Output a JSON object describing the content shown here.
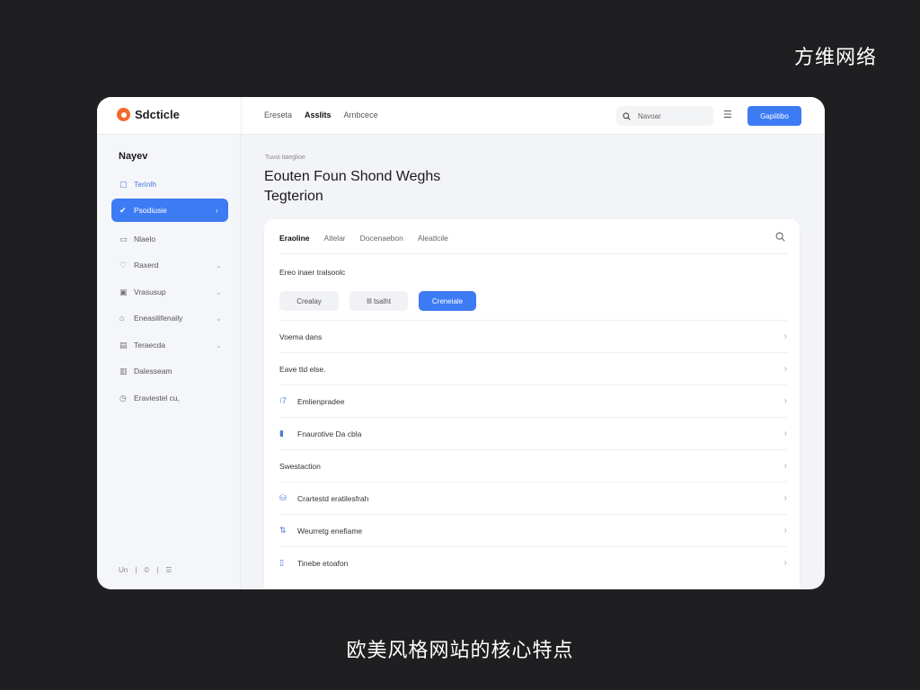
{
  "overlay": {
    "corner_text": "方维网络",
    "caption": "欧美风格网站的核心特点"
  },
  "topbar": {
    "logo_text": "Sdcticle",
    "nav": [
      "Ereseta",
      "Asslits",
      "Arnbcece"
    ],
    "search_placeholder": "Navoar",
    "primary_button": "Gapiitibo"
  },
  "sidebar": {
    "title": "Nayev",
    "items": [
      {
        "label": "Terinlh",
        "icon": "square-icon",
        "glyph": "▢",
        "chevron": false
      },
      {
        "label": "Psodiusie",
        "icon": "check-shield-icon",
        "glyph": "✔",
        "chevron": true
      },
      {
        "label": "Nlaelo",
        "icon": "tag-icon",
        "glyph": "▭",
        "chevron": false
      },
      {
        "label": "Raxerd",
        "icon": "pin-icon",
        "glyph": "♡",
        "chevron": true
      },
      {
        "label": "Vrasusup",
        "icon": "image-icon",
        "glyph": "▣",
        "chevron": true
      },
      {
        "label": "Eneasilifenaily",
        "icon": "home-icon",
        "glyph": "⌂",
        "chevron": true
      },
      {
        "label": "Teraecda",
        "icon": "list-icon",
        "glyph": "▤",
        "chevron": true
      },
      {
        "label": "Dalesseam",
        "icon": "folder-icon",
        "glyph": "▥",
        "chevron": false
      },
      {
        "label": "Eraviestel cu,",
        "icon": "clock-icon",
        "glyph": "◷",
        "chevron": false
      }
    ],
    "footer": [
      "Un",
      "|",
      "©",
      "|",
      "☰"
    ]
  },
  "main": {
    "breadcrumb": "Tuvoi itaeglioe",
    "title_line1": "Eouten Foun Shond Weghs",
    "title_line2": "Tegterion"
  },
  "card": {
    "tabs": [
      "Eraoline",
      "Atlelar",
      "Docenaebon",
      "Aleatlcile"
    ],
    "section_label": "Ereo inaer tralsoolc",
    "pills": [
      "Crealay",
      "Ill tsalht",
      "Creneiale"
    ],
    "rows": [
      {
        "label": "Voema dans",
        "icon": "",
        "glyph": ""
      },
      {
        "label": "Eave ttd else.",
        "icon": "",
        "glyph": ""
      },
      {
        "label": "Emlienpradee",
        "icon": "bar-chart-icon",
        "glyph": "⁝7"
      },
      {
        "label": "Fnaurotive Da cbla",
        "icon": "document-icon",
        "glyph": "▮"
      },
      {
        "label": "Swestaction",
        "icon": "",
        "glyph": ""
      },
      {
        "label": "Crartestd eratilesfrah",
        "icon": "user-group-icon",
        "glyph": "⛁"
      },
      {
        "label": "Weurretg enefiame",
        "icon": "trend-icon",
        "glyph": "⇅"
      },
      {
        "label": "Tinebe etoafon",
        "icon": "book-icon",
        "glyph": "▯"
      }
    ]
  },
  "colors": {
    "accent": "#3d7bf4",
    "logo": "#f26a2e",
    "background": "#1f1f21"
  }
}
